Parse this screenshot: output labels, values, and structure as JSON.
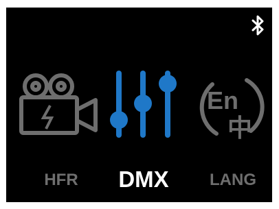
{
  "status_bar": {
    "bluetooth_icon": "bluetooth-icon"
  },
  "modes": [
    {
      "label": "HFR",
      "icon": "video-camera-flash-icon",
      "selected": false
    },
    {
      "label": "DMX",
      "icon": "sliders-icon",
      "selected": true
    },
    {
      "label": "LANG",
      "icon": "language-en-zh-icon",
      "selected": false
    }
  ],
  "colors": {
    "background": "#000000",
    "accent": "#1f78c8",
    "inactive": "#6e6e6e",
    "active_text": "#ffffff"
  },
  "lang_icon": {
    "top_text": "En",
    "bottom_text": "中"
  }
}
